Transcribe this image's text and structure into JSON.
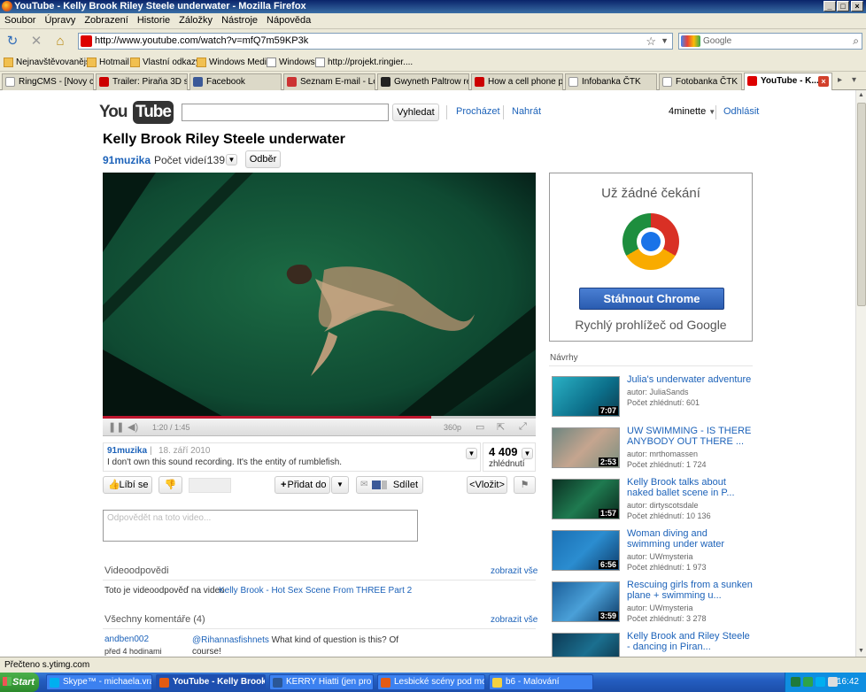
{
  "window": {
    "title": "YouTube - Kelly Brook Riley Steele underwater - Mozilla Firefox"
  },
  "menu": [
    "Soubor",
    "Úpravy",
    "Zobrazení",
    "Historie",
    "Záložky",
    "Nástroje",
    "Nápověda"
  ],
  "nav": {
    "url": "http://www.youtube.com/watch?v=mfQ7m59KP3k",
    "search_placeholder": "Google"
  },
  "bookmarks": [
    "Nejnavštěvovanější",
    "Hotmail",
    "Vlastní odkazy",
    "Windows Media",
    "Windows",
    "http://projekt.ringier...."
  ],
  "tabs": [
    "RingCMS - [Novy cl...",
    "Trailer: Piraňa 3D si...",
    "Facebook",
    "Seznam E-mail - Login",
    "Gwyneth Paltrow re...",
    "How a cell phone pi...",
    "Infobanka ČTK",
    "Fotobanka ČTK",
    "YouTube - K..."
  ],
  "yt": {
    "logo_you": "You",
    "logo_tube": "Tube",
    "search_button": "Vyhledat",
    "browse": "Procházet",
    "upload": "Nahrát",
    "user": "4minette",
    "logout": "Odhlásit",
    "video_title": "Kelly Brook Riley Steele underwater",
    "channel": "91muzika",
    "video_count_label": "Počet videí:",
    "video_count": "139",
    "subscribe": "Odběr",
    "time": "1:20 / 1:45",
    "quality": "360p",
    "uploader": "91muzika",
    "date": "18. září 2010",
    "description": "I don't own this sound recording. It's the entity of rumblefish.",
    "views": "4 409",
    "views_label": "zhlédnutí",
    "like": "Líbí se",
    "add_to": "Přidat do",
    "share": "Sdílet",
    "embed": "<Vložit>",
    "reply_placeholder": "Odpovědět na toto video...",
    "video_responses": "Videoodpovědi",
    "show_all": "zobrazit vše",
    "response_text": "Toto je videoodpověď na video",
    "response_link": "Kelly Brook - Hot Sex Scene From THREE Part 2",
    "all_comments": "Všechny komentáře (4)",
    "comment_user": "andben002",
    "comment_time": "před 4 hodinami",
    "comment_mention": "@Rihannasfishnets",
    "comment_text": "What kind of question is this? Of course!"
  },
  "ad": {
    "headline": "Už žádné čekání",
    "button": "Stáhnout Chrome",
    "tagline": "Rychlý prohlížeč od Google"
  },
  "suggestions_header": "Návrhy",
  "suggestions": [
    {
      "title": "Julia's underwater adventure",
      "author": "autor: JuliaSands",
      "views": "Počet zhlédnutí: 601",
      "dur": "7:07"
    },
    {
      "title": "UW SWIMMING - IS THERE ANYBODY OUT THERE ...",
      "author": "autor: mrthomassen",
      "views": "Počet zhlédnutí: 1 724",
      "dur": "2:53"
    },
    {
      "title": "Kelly Brook talks about naked ballet scene in P...",
      "author": "autor: dirtyscotsdale",
      "views": "Počet zhlédnutí: 10 136",
      "dur": "1:57"
    },
    {
      "title": "Woman diving and swimming under water",
      "author": "autor: UWmysteria",
      "views": "Počet zhlédnutí: 1 973",
      "dur": "6:56"
    },
    {
      "title": "Rescuing girls from a sunken plane + swimming u...",
      "author": "autor: UWmysteria",
      "views": "Počet zhlédnutí: 3 278",
      "dur": "3:59"
    },
    {
      "title": "Kelly Brook and Riley Steele - dancing in Piran...",
      "author": "",
      "views": "",
      "dur": ""
    }
  ],
  "status": "Přečteno s.ytimg.com",
  "taskbar": {
    "start": "Start",
    "items": [
      "Skype™ - michaela.vran...",
      "YouTube - Kelly Brook...",
      "KERRY Hiatti (jen pro čte...",
      "Lesbické scény pod mors...",
      "b6 - Malování"
    ],
    "clock": "16:42"
  }
}
